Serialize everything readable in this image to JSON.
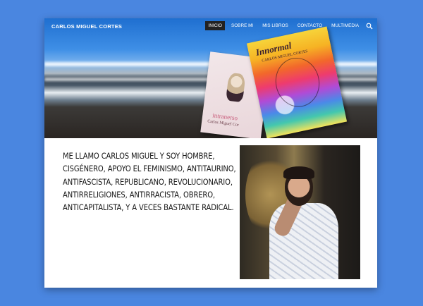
{
  "site": {
    "brand": "CARLOS MIGUEL CORTES"
  },
  "nav": {
    "items": [
      {
        "label": "INICIO",
        "active": true
      },
      {
        "label": "SOBRE MI",
        "active": false
      },
      {
        "label": "MIS LIBROS",
        "active": false
      },
      {
        "label": "CONTACTO",
        "active": false
      },
      {
        "label": "MULTIMEDIA",
        "active": false
      }
    ],
    "search_icon": "search-icon"
  },
  "hero": {
    "book_left": {
      "title": "intranerso",
      "author": "Carlos Miguel Cor"
    },
    "book_right": {
      "title": "Innormal",
      "author": "CARLOS MIGUEL CORTES"
    }
  },
  "bio": {
    "text": "Me llamo Carlos Miguel y soy hombre, cisgénero, apoyo el feminismo, antitaurino, antifascista, republicano, revolucionario, antirreligiones, antirracista, obrero, anticapitalista, y a veces bastante radical."
  },
  "colors": {
    "page_background": "#4a86e0",
    "nav_active_bg": "#222222",
    "text": "#161616"
  }
}
